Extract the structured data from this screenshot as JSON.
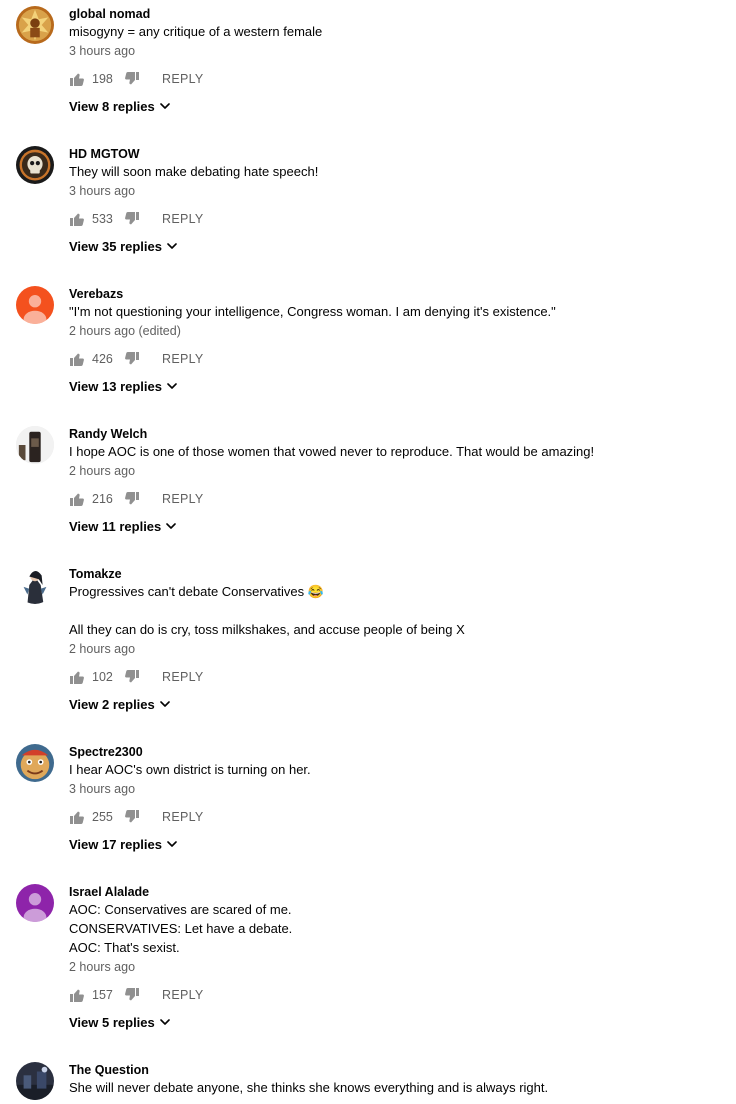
{
  "comments": [
    {
      "author": "global nomad",
      "text": [
        "misogyny = any critique of a western female"
      ],
      "time": "3 hours ago",
      "likes": "198",
      "reply_label": "REPLY",
      "replies_label": "View 8 replies",
      "avatar_icon": "golden-warrior-avatar",
      "avatar_color": "#d9a24a"
    },
    {
      "author": "HD MGTOW",
      "text": [
        "They will soon make debating hate speech!"
      ],
      "time": "3 hours ago",
      "likes": "533",
      "reply_label": "REPLY",
      "replies_label": "View 35 replies",
      "avatar_icon": "skull-emblem-avatar",
      "avatar_color": "#1a1a1a"
    },
    {
      "author": "Verebazs",
      "text": [
        "\"I'm not questioning your intelligence, Congress woman. I am denying it's existence.\""
      ],
      "time": "2 hours ago (edited)",
      "likes": "426",
      "reply_label": "REPLY",
      "replies_label": "View 13 replies",
      "avatar_icon": "default-user-avatar",
      "avatar_color": "#f4511e"
    },
    {
      "author": "Randy Welch",
      "text": [
        "I hope AOC is one of those women that vowed never to reproduce. That would be amazing!"
      ],
      "time": "2 hours ago",
      "likes": "216",
      "reply_label": "REPLY",
      "replies_label": "View 11 replies",
      "avatar_icon": "bottle-photo-avatar",
      "avatar_color": "#e8e8e8"
    },
    {
      "author": "Tomakze",
      "text": [
        "Progressives can't debate Conservatives 😂",
        "",
        "All they can do is cry, toss milkshakes, and accuse people of being X"
      ],
      "time": "2 hours ago",
      "likes": "102",
      "reply_label": "REPLY",
      "replies_label": "View 2 replies",
      "avatar_icon": "anime-character-avatar",
      "avatar_color": "#ffffff"
    },
    {
      "author": "Spectre2300",
      "text": [
        "I hear AOC's own district is turning on her."
      ],
      "time": "3 hours ago",
      "likes": "255",
      "reply_label": "REPLY",
      "replies_label": "View 17 replies",
      "avatar_icon": "cartoon-face-avatar",
      "avatar_color": "#e0a85a"
    },
    {
      "author": "Israel Alalade",
      "text": [
        "AOC: Conservatives are scared of me.",
        "CONSERVATIVES: Let have a debate.",
        "AOC: That's sexist."
      ],
      "time": "2 hours ago",
      "likes": "157",
      "reply_label": "REPLY",
      "replies_label": "View 5 replies",
      "avatar_icon": "default-user-avatar",
      "avatar_color": "#8e24aa"
    },
    {
      "author": "The Question",
      "text": [
        "She will never debate anyone, she thinks she knows everything and is always right."
      ],
      "time": "",
      "likes": "",
      "reply_label": "",
      "replies_label": "",
      "avatar_icon": "night-scene-avatar",
      "avatar_color": "#2b3040"
    }
  ]
}
